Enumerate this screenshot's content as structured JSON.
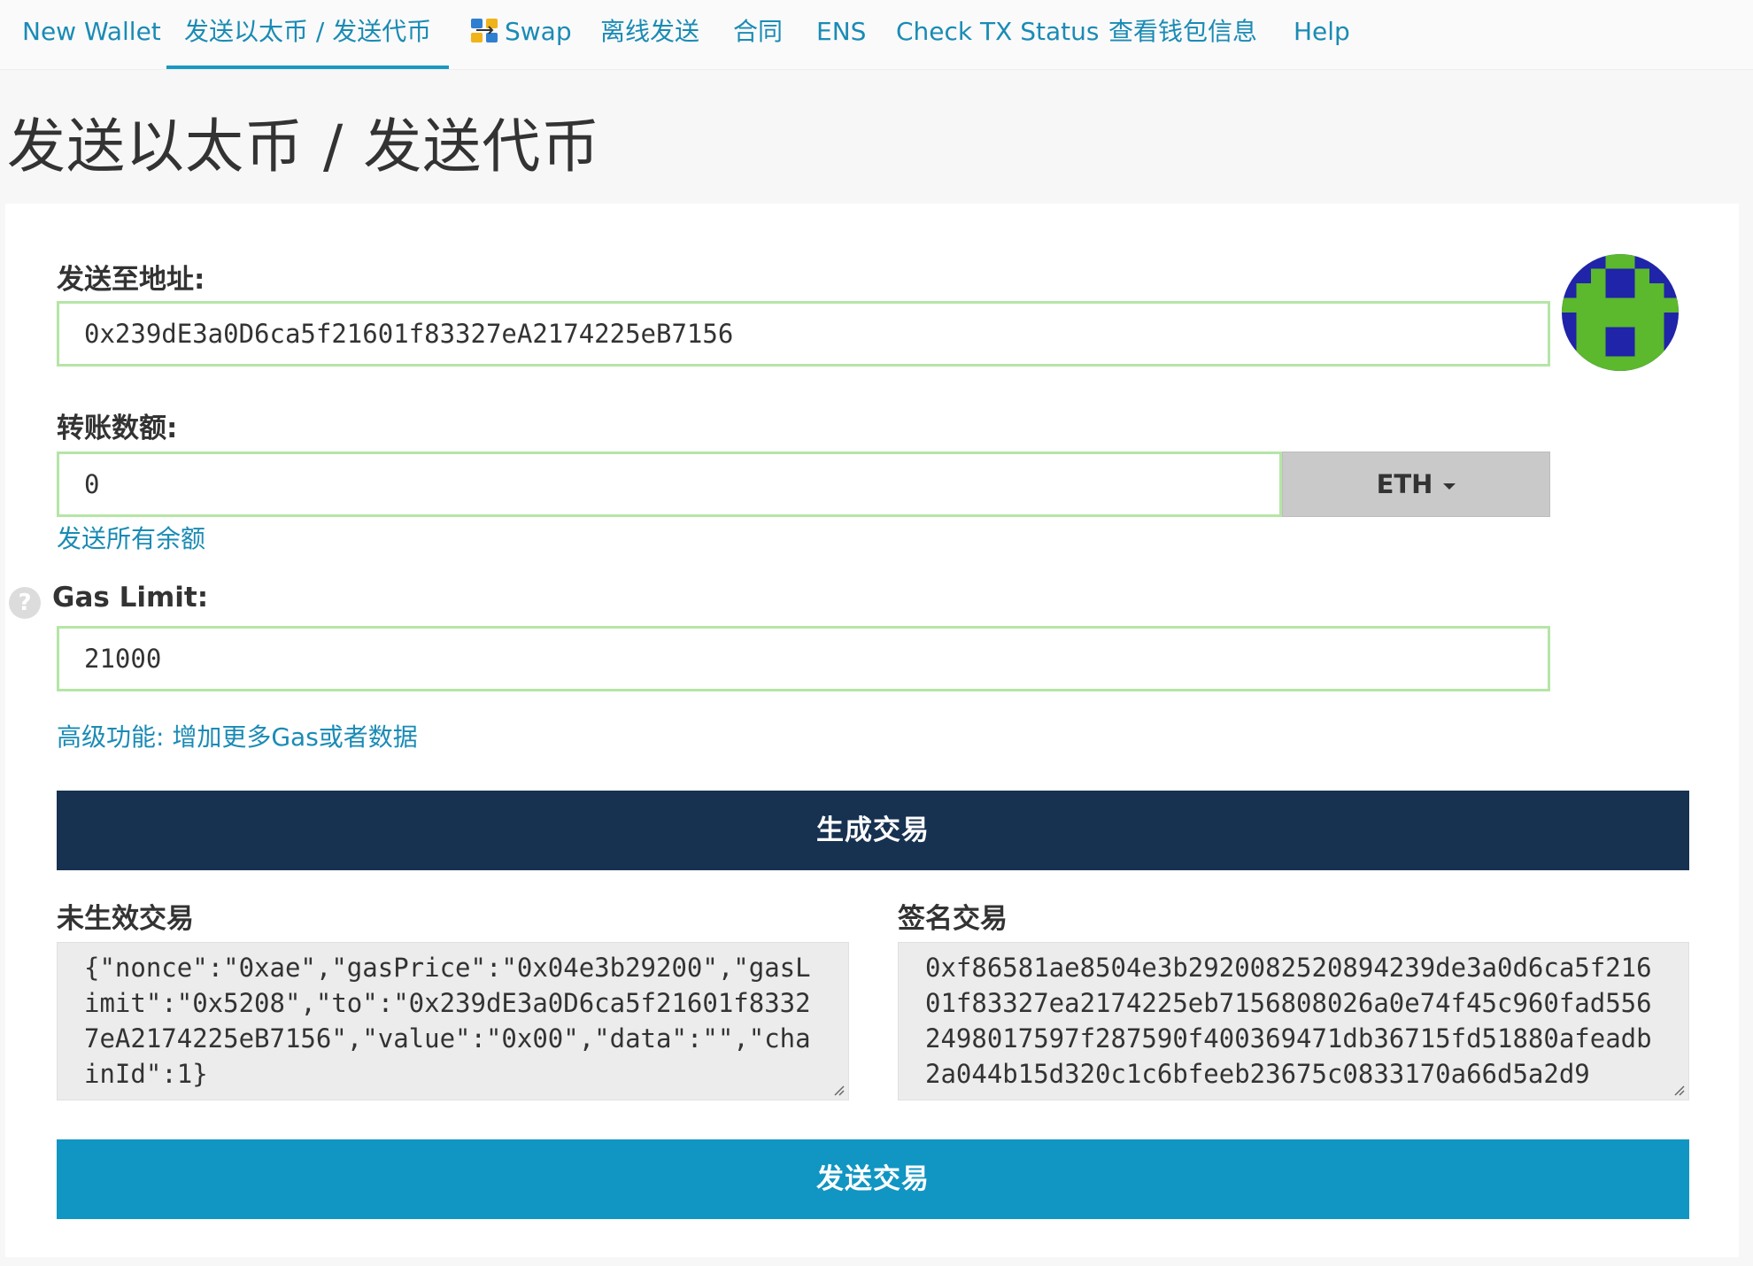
{
  "nav": {
    "items": [
      {
        "label": "New Wallet",
        "active": false
      },
      {
        "label": "发送以太币 / 发送代币",
        "active": true
      },
      {
        "label": "Swap",
        "active": false,
        "icon": "swap-icon"
      },
      {
        "label": "离线发送",
        "active": false
      },
      {
        "label": "合同",
        "active": false
      },
      {
        "label": "ENS",
        "active": false
      },
      {
        "label": "Check TX Status",
        "active": false
      },
      {
        "label": "查看钱包信息",
        "active": false
      },
      {
        "label": "Help",
        "active": false
      }
    ]
  },
  "page": {
    "title": "发送以太币 / 发送代币"
  },
  "form": {
    "to_address": {
      "label": "发送至地址:",
      "value": "0x239dE3a0D6ca5f21601f83327eA2174225eB7156"
    },
    "amount": {
      "label": "转账数额:",
      "value": "0",
      "currency": "ETH",
      "send_all_link": "发送所有余额"
    },
    "gas_limit": {
      "help_glyph": "?",
      "label": "Gas Limit:",
      "value": "21000"
    },
    "advanced_link": "高级功能: 增加更多Gas或者数据",
    "generate_button": "生成交易",
    "raw_tx": {
      "label": "未生效交易",
      "value": "{\"nonce\":\"0xae\",\"gasPrice\":\"0x04e3b29200\",\"gasLimit\":\"0x5208\",\"to\":\"0x239dE3a0D6ca5f21601f83327eA2174225eB7156\",\"value\":\"0x00\",\"data\":\"\",\"chainId\":1}"
    },
    "signed_tx": {
      "label": "签名交易",
      "value": "0xf86581ae8504e3b2920082520894239de3a0d6ca5f21601f83327ea2174225eb7156808026a0e74f45c960fad5562498017597f287590f400369471db36715fd51880afeadb2a044b15d320c1c6bfeeb23675c0833170a66d5a2d9"
    },
    "send_button": "发送交易"
  },
  "colors": {
    "link": "#1a8bb5",
    "valid_border": "#b5e5a6",
    "dark_button": "#173150",
    "blue_button": "#1195c2",
    "identicon_blue": "#1f24a8",
    "identicon_green": "#5cb82c"
  }
}
